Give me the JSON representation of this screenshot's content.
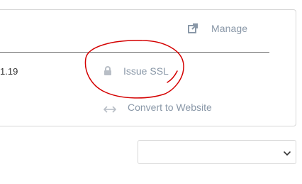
{
  "card": {
    "ip_fragment": "1.19",
    "manage_label": "Manage",
    "issue_ssl_label": "Issue SSL",
    "convert_label": "Convert to Website"
  },
  "icons": {
    "manage": "external-link-icon",
    "issue_ssl": "lock-icon",
    "convert": "arrows-horizontal-icon"
  },
  "dropdown": {
    "selected_value": ""
  },
  "colors": {
    "link": "#8a98a8",
    "annotation": "#d40000",
    "border": "#d7d7d7"
  }
}
